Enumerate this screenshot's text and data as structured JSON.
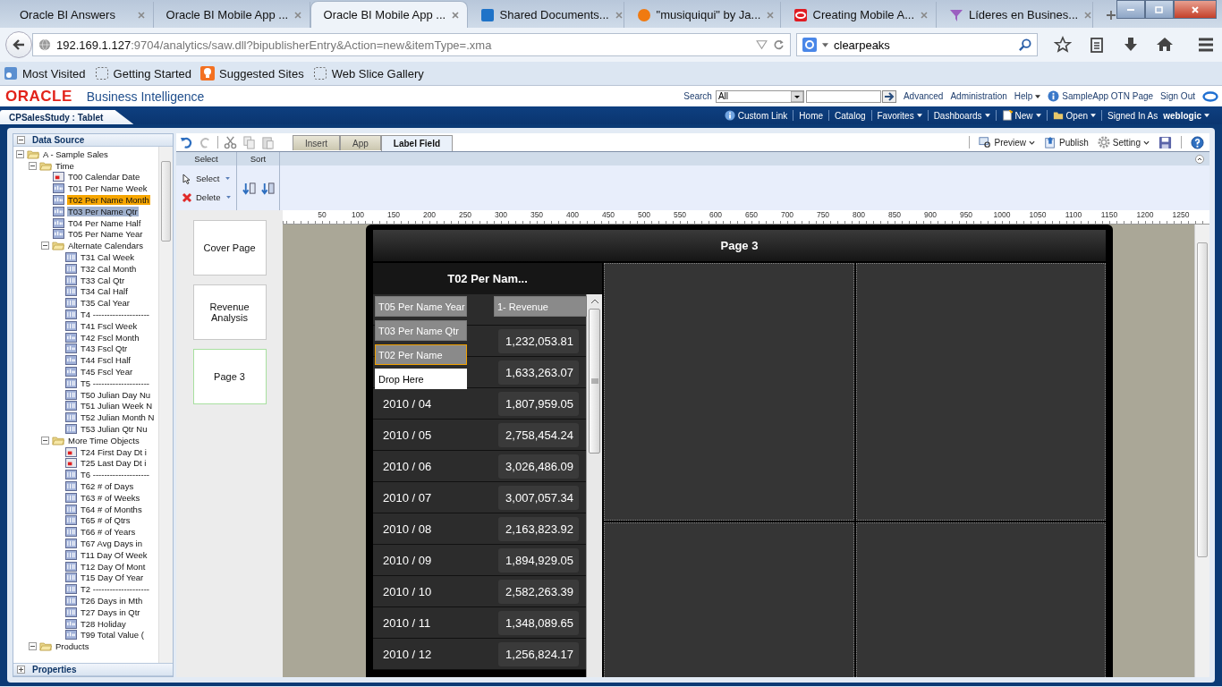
{
  "browser": {
    "tabs": [
      {
        "label": "Oracle BI Answers",
        "selected": false,
        "kind": "plain"
      },
      {
        "label": "Oracle BI Mobile App ...",
        "selected": false,
        "kind": "plain"
      },
      {
        "label": "Oracle BI Mobile App ...",
        "selected": true,
        "kind": "plain"
      },
      {
        "label": "Shared Documents...",
        "selected": false,
        "kind": "sharepoint"
      },
      {
        "label": "\"musiquiqui\" by Ja...",
        "selected": false,
        "kind": "audio"
      },
      {
        "label": "Creating Mobile A...",
        "selected": false,
        "kind": "oracle"
      },
      {
        "label": "Líderes en Busines...",
        "selected": false,
        "kind": "funnel"
      }
    ],
    "url_host": "192.169.1.127",
    "url_rest": ":9704/analytics/saw.dll?bipublisherEntry&Action=new&itemType=.xma",
    "search_value": "clearpeaks",
    "bookmarks": [
      {
        "label": "Most Visited",
        "kind": "feed"
      },
      {
        "label": "Getting Started",
        "kind": "slice"
      },
      {
        "label": "Suggested Sites",
        "kind": "suggest"
      },
      {
        "label": "Web Slice Gallery",
        "kind": "slice"
      }
    ]
  },
  "header": {
    "logo": "ORACLE",
    "product": "Business Intelligence",
    "search_label": "Search",
    "search_scope": "All",
    "links": [
      {
        "label": "Advanced",
        "menu": false
      },
      {
        "label": "Administration",
        "menu": false
      },
      {
        "label": "Help",
        "menu": true
      },
      {
        "label": "SampleApp OTN Page",
        "menu": false
      },
      {
        "label": "Sign Out",
        "menu": false
      }
    ]
  },
  "nav": {
    "title": "CPSalesStudy : Tablet",
    "links": [
      {
        "label": "Custom Link",
        "menu": false
      },
      {
        "label": "Home",
        "menu": false
      },
      {
        "label": "Catalog",
        "menu": false
      },
      {
        "label": "Favorites",
        "menu": true
      },
      {
        "label": "Dashboards",
        "menu": true
      },
      {
        "label": "New",
        "menu": true
      },
      {
        "label": "Open",
        "menu": true
      }
    ],
    "signed_in_label": "Signed In As",
    "user": "weblogic"
  },
  "data_source": {
    "title": "Data Source",
    "properties_title": "Properties",
    "tree": [
      {
        "label": "A - Sample Sales",
        "kind": "folder",
        "expanded": true,
        "children": [
          {
            "label": "Time",
            "kind": "folder",
            "expanded": true,
            "children": [
              {
                "label": "T00 Calendar Date",
                "kind": "date",
                "selected": false,
                "dragged": false
              },
              {
                "label": "T01 Per Name Week",
                "kind": "text",
                "selected": false,
                "dragged": false
              },
              {
                "label": "T02 Per Name Month",
                "kind": "text",
                "selected": false,
                "dragged": true
              },
              {
                "label": "T03 Per Name Qtr",
                "kind": "text",
                "selected": true,
                "dragged": false
              },
              {
                "label": "T04 Per Name Half",
                "kind": "text",
                "selected": false,
                "dragged": false
              },
              {
                "label": "T05 Per Name Year",
                "kind": "text",
                "selected": false,
                "dragged": false
              },
              {
                "label": "Alternate Calendars",
                "kind": "folder",
                "expanded": true,
                "children": [
                  {
                    "label": "T31 Cal Week",
                    "kind": "number",
                    "selected": false,
                    "dragged": false
                  },
                  {
                    "label": "T32 Cal Month",
                    "kind": "number",
                    "selected": false,
                    "dragged": false
                  },
                  {
                    "label": "T33 Cal Qtr",
                    "kind": "number",
                    "selected": false,
                    "dragged": false
                  },
                  {
                    "label": "T34 Cal Half",
                    "kind": "number",
                    "selected": false,
                    "dragged": false
                  },
                  {
                    "label": "T35 Cal Year",
                    "kind": "number",
                    "selected": false,
                    "dragged": false
                  },
                  {
                    "label": "T4 --------------------",
                    "kind": "number",
                    "selected": false,
                    "dragged": false
                  },
                  {
                    "label": "T41 Fscl Week",
                    "kind": "number",
                    "selected": false,
                    "dragged": false
                  },
                  {
                    "label": "T42 Fscl Month",
                    "kind": "text",
                    "selected": false,
                    "dragged": false
                  },
                  {
                    "label": "T43 Fscl Qtr",
                    "kind": "text",
                    "selected": false,
                    "dragged": false
                  },
                  {
                    "label": "T44 Fscl Half",
                    "kind": "text",
                    "selected": false,
                    "dragged": false
                  },
                  {
                    "label": "T45 Fscl Year",
                    "kind": "text",
                    "selected": false,
                    "dragged": false
                  },
                  {
                    "label": "T5 --------------------",
                    "kind": "number",
                    "selected": false,
                    "dragged": false
                  },
                  {
                    "label": "T50 Julian Day Nu",
                    "kind": "number",
                    "selected": false,
                    "dragged": false
                  },
                  {
                    "label": "T51 Julian Week N",
                    "kind": "number",
                    "selected": false,
                    "dragged": false
                  },
                  {
                    "label": "T52 Julian Month N",
                    "kind": "number",
                    "selected": false,
                    "dragged": false
                  },
                  {
                    "label": "T53 Julian Qtr Nu",
                    "kind": "number",
                    "selected": false,
                    "dragged": false
                  }
                ]
              },
              {
                "label": "More Time Objects",
                "kind": "folder",
                "expanded": true,
                "children": [
                  {
                    "label": "T24 First Day Dt i",
                    "kind": "date",
                    "selected": false,
                    "dragged": false
                  },
                  {
                    "label": "T25 Last Day Dt i",
                    "kind": "date",
                    "selected": false,
                    "dragged": false
                  },
                  {
                    "label": "T6 --------------------",
                    "kind": "number",
                    "selected": false,
                    "dragged": false
                  },
                  {
                    "label": "T62 # of Days",
                    "kind": "number",
                    "selected": false,
                    "dragged": false
                  },
                  {
                    "label": "T63 # of Weeks",
                    "kind": "number",
                    "selected": false,
                    "dragged": false
                  },
                  {
                    "label": "T64 # of Months",
                    "kind": "number",
                    "selected": false,
                    "dragged": false
                  },
                  {
                    "label": "T65 # of Qtrs",
                    "kind": "number",
                    "selected": false,
                    "dragged": false
                  },
                  {
                    "label": "T66 # of Years",
                    "kind": "number",
                    "selected": false,
                    "dragged": false
                  },
                  {
                    "label": "T67 Avg Days in",
                    "kind": "number",
                    "selected": false,
                    "dragged": false
                  },
                  {
                    "label": "T11 Day Of Week",
                    "kind": "number",
                    "selected": false,
                    "dragged": false
                  },
                  {
                    "label": "T12 Day Of Mont",
                    "kind": "number",
                    "selected": false,
                    "dragged": false
                  },
                  {
                    "label": "T15 Day Of Year",
                    "kind": "number",
                    "selected": false,
                    "dragged": false
                  },
                  {
                    "label": "T2 --------------------",
                    "kind": "number",
                    "selected": false,
                    "dragged": false
                  },
                  {
                    "label": "T26 Days in Mth",
                    "kind": "number",
                    "selected": false,
                    "dragged": false
                  },
                  {
                    "label": "T27 Days in Qtr",
                    "kind": "number",
                    "selected": false,
                    "dragged": false
                  },
                  {
                    "label": "T28 Holiday",
                    "kind": "text",
                    "selected": false,
                    "dragged": false
                  },
                  {
                    "label": "T99 Total Value (",
                    "kind": "text",
                    "selected": false,
                    "dragged": false
                  }
                ]
              }
            ]
          },
          {
            "label": "Products",
            "kind": "folder",
            "expanded": true
          }
        ]
      }
    ]
  },
  "editor": {
    "tabs": [
      {
        "label": "Insert",
        "selected": false
      },
      {
        "label": "App",
        "selected": false
      },
      {
        "label": "Label Field",
        "selected": true
      }
    ],
    "actions": [
      {
        "label": "Preview",
        "kind": "preview"
      },
      {
        "label": "Publish",
        "kind": "publish"
      },
      {
        "label": "Setting",
        "kind": "setting"
      }
    ],
    "select_group": {
      "title": "Select",
      "items": [
        {
          "label": "Select",
          "kind": "pointer"
        },
        {
          "label": "Delete",
          "kind": "delete"
        }
      ]
    },
    "sort_group": {
      "title": "Sort"
    },
    "ruler": [
      "50",
      "100",
      "150",
      "200",
      "250",
      "300",
      "350",
      "400",
      "450",
      "500",
      "550",
      "600",
      "650",
      "700",
      "750",
      "800",
      "850",
      "900",
      "950",
      "1000",
      "1050",
      "1100",
      "1150",
      "1200",
      "1250"
    ],
    "pages": [
      {
        "label": "Cover Page",
        "selected": false
      },
      {
        "label": "Revenue Analysis",
        "selected": false
      },
      {
        "label": "Page 3",
        "selected": true
      }
    ]
  },
  "phone": {
    "page_title": "Page 3",
    "column_title": "T02 Per Nam...",
    "rows": [
      {
        "value": "1,232,053.81"
      },
      {
        "value": "1,633,263.07"
      },
      {
        "date": "2010 / 04",
        "value": "1,807,959.05"
      },
      {
        "date": "2010 / 05",
        "value": "2,758,454.24"
      },
      {
        "date": "2010 / 06",
        "value": "3,026,486.09"
      },
      {
        "date": "2010 / 07",
        "value": "3,007,057.34"
      },
      {
        "date": "2010 / 08",
        "value": "2,163,823.92"
      },
      {
        "date": "2010 / 09",
        "value": "1,894,929.05"
      },
      {
        "date": "2010 / 10",
        "value": "2,582,263.39"
      },
      {
        "date": "2010 / 11",
        "value": "1,348,089.65"
      },
      {
        "date": "2010 / 12",
        "value": "1,256,824.17"
      }
    ],
    "drag_fields": [
      {
        "label": "T05 Per Name Year",
        "kind": "field",
        "selected": false
      },
      {
        "label": "T03 Per Name Qtr",
        "kind": "field",
        "selected": false
      },
      {
        "label": "T02 Per Name",
        "kind": "field",
        "selected": true
      },
      {
        "label": "Drop Here",
        "kind": "target",
        "selected": false
      },
      {
        "label": "1- Revenue",
        "kind": "measure",
        "selected": false
      }
    ]
  }
}
